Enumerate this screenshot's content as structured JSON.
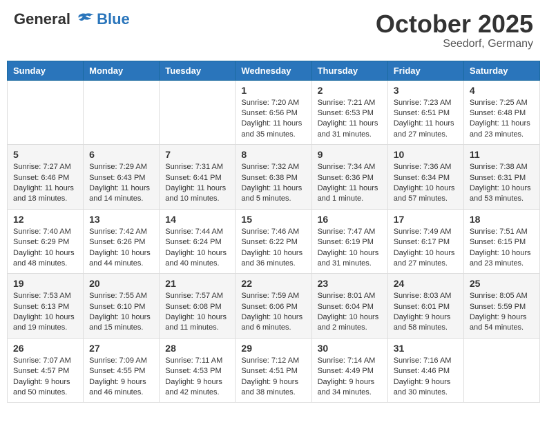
{
  "header": {
    "logo_line1": "General",
    "logo_line2": "Blue",
    "month": "October 2025",
    "location": "Seedorf, Germany"
  },
  "weekdays": [
    "Sunday",
    "Monday",
    "Tuesday",
    "Wednesday",
    "Thursday",
    "Friday",
    "Saturday"
  ],
  "weeks": [
    [
      {
        "day": "",
        "info": ""
      },
      {
        "day": "",
        "info": ""
      },
      {
        "day": "",
        "info": ""
      },
      {
        "day": "1",
        "info": "Sunrise: 7:20 AM\nSunset: 6:56 PM\nDaylight: 11 hours\nand 35 minutes."
      },
      {
        "day": "2",
        "info": "Sunrise: 7:21 AM\nSunset: 6:53 PM\nDaylight: 11 hours\nand 31 minutes."
      },
      {
        "day": "3",
        "info": "Sunrise: 7:23 AM\nSunset: 6:51 PM\nDaylight: 11 hours\nand 27 minutes."
      },
      {
        "day": "4",
        "info": "Sunrise: 7:25 AM\nSunset: 6:48 PM\nDaylight: 11 hours\nand 23 minutes."
      }
    ],
    [
      {
        "day": "5",
        "info": "Sunrise: 7:27 AM\nSunset: 6:46 PM\nDaylight: 11 hours\nand 18 minutes."
      },
      {
        "day": "6",
        "info": "Sunrise: 7:29 AM\nSunset: 6:43 PM\nDaylight: 11 hours\nand 14 minutes."
      },
      {
        "day": "7",
        "info": "Sunrise: 7:31 AM\nSunset: 6:41 PM\nDaylight: 11 hours\nand 10 minutes."
      },
      {
        "day": "8",
        "info": "Sunrise: 7:32 AM\nSunset: 6:38 PM\nDaylight: 11 hours\nand 5 minutes."
      },
      {
        "day": "9",
        "info": "Sunrise: 7:34 AM\nSunset: 6:36 PM\nDaylight: 11 hours\nand 1 minute."
      },
      {
        "day": "10",
        "info": "Sunrise: 7:36 AM\nSunset: 6:34 PM\nDaylight: 10 hours\nand 57 minutes."
      },
      {
        "day": "11",
        "info": "Sunrise: 7:38 AM\nSunset: 6:31 PM\nDaylight: 10 hours\nand 53 minutes."
      }
    ],
    [
      {
        "day": "12",
        "info": "Sunrise: 7:40 AM\nSunset: 6:29 PM\nDaylight: 10 hours\nand 48 minutes."
      },
      {
        "day": "13",
        "info": "Sunrise: 7:42 AM\nSunset: 6:26 PM\nDaylight: 10 hours\nand 44 minutes."
      },
      {
        "day": "14",
        "info": "Sunrise: 7:44 AM\nSunset: 6:24 PM\nDaylight: 10 hours\nand 40 minutes."
      },
      {
        "day": "15",
        "info": "Sunrise: 7:46 AM\nSunset: 6:22 PM\nDaylight: 10 hours\nand 36 minutes."
      },
      {
        "day": "16",
        "info": "Sunrise: 7:47 AM\nSunset: 6:19 PM\nDaylight: 10 hours\nand 31 minutes."
      },
      {
        "day": "17",
        "info": "Sunrise: 7:49 AM\nSunset: 6:17 PM\nDaylight: 10 hours\nand 27 minutes."
      },
      {
        "day": "18",
        "info": "Sunrise: 7:51 AM\nSunset: 6:15 PM\nDaylight: 10 hours\nand 23 minutes."
      }
    ],
    [
      {
        "day": "19",
        "info": "Sunrise: 7:53 AM\nSunset: 6:13 PM\nDaylight: 10 hours\nand 19 minutes."
      },
      {
        "day": "20",
        "info": "Sunrise: 7:55 AM\nSunset: 6:10 PM\nDaylight: 10 hours\nand 15 minutes."
      },
      {
        "day": "21",
        "info": "Sunrise: 7:57 AM\nSunset: 6:08 PM\nDaylight: 10 hours\nand 11 minutes."
      },
      {
        "day": "22",
        "info": "Sunrise: 7:59 AM\nSunset: 6:06 PM\nDaylight: 10 hours\nand 6 minutes."
      },
      {
        "day": "23",
        "info": "Sunrise: 8:01 AM\nSunset: 6:04 PM\nDaylight: 10 hours\nand 2 minutes."
      },
      {
        "day": "24",
        "info": "Sunrise: 8:03 AM\nSunset: 6:01 PM\nDaylight: 9 hours\nand 58 minutes."
      },
      {
        "day": "25",
        "info": "Sunrise: 8:05 AM\nSunset: 5:59 PM\nDaylight: 9 hours\nand 54 minutes."
      }
    ],
    [
      {
        "day": "26",
        "info": "Sunrise: 7:07 AM\nSunset: 4:57 PM\nDaylight: 9 hours\nand 50 minutes."
      },
      {
        "day": "27",
        "info": "Sunrise: 7:09 AM\nSunset: 4:55 PM\nDaylight: 9 hours\nand 46 minutes."
      },
      {
        "day": "28",
        "info": "Sunrise: 7:11 AM\nSunset: 4:53 PM\nDaylight: 9 hours\nand 42 minutes."
      },
      {
        "day": "29",
        "info": "Sunrise: 7:12 AM\nSunset: 4:51 PM\nDaylight: 9 hours\nand 38 minutes."
      },
      {
        "day": "30",
        "info": "Sunrise: 7:14 AM\nSunset: 4:49 PM\nDaylight: 9 hours\nand 34 minutes."
      },
      {
        "day": "31",
        "info": "Sunrise: 7:16 AM\nSunset: 4:46 PM\nDaylight: 9 hours\nand 30 minutes."
      },
      {
        "day": "",
        "info": ""
      }
    ]
  ]
}
